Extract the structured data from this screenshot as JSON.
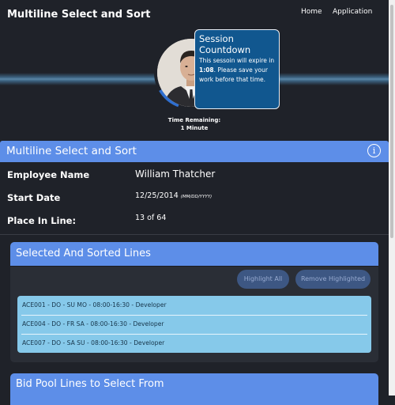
{
  "app": {
    "title": "Multiline Select and Sort"
  },
  "nav": {
    "home": "Home",
    "application": "Application"
  },
  "session": {
    "time_remaining_label": "Time Remaining:",
    "time_remaining_value": "1 Minute",
    "countdown_progress": 0.11,
    "popup_title": "Session Countdown",
    "popup_text_before": "This sessoin will expire in ",
    "popup_time": "1:08",
    "popup_text_after": ". Please save your work before that time."
  },
  "header": {
    "title": "Multiline Select and Sort",
    "info_icon": "info-icon"
  },
  "employee": {
    "name_label": "Employee Name",
    "name_value": "William Thatcher",
    "start_label": "Start Date",
    "start_value": "12/25/2014",
    "start_format": "(MM/DD/YYYY)",
    "place_label": "Place In Line:",
    "place_value": "13 of 64"
  },
  "selected_panel": {
    "title": "Selected And Sorted Lines",
    "highlight_all": "Highlight All",
    "remove_highlighted": "Remove Highlighted",
    "lines": [
      "ACE001 - DO - SU MO - 08:00-16:30 - Developer",
      "ACE004 - DO - FR SA - 08:00-16:30 - Developer",
      "ACE007 - DO - SA SU - 08:00-16:30 - Developer"
    ]
  },
  "bid_panel": {
    "title": "Bid Pool Lines to Select From"
  },
  "colors": {
    "background": "#1f2229",
    "accent": "#5d8ee8",
    "popup": "#11578f",
    "line_highlight": "#86c9ea",
    "button": "#3d5783"
  }
}
